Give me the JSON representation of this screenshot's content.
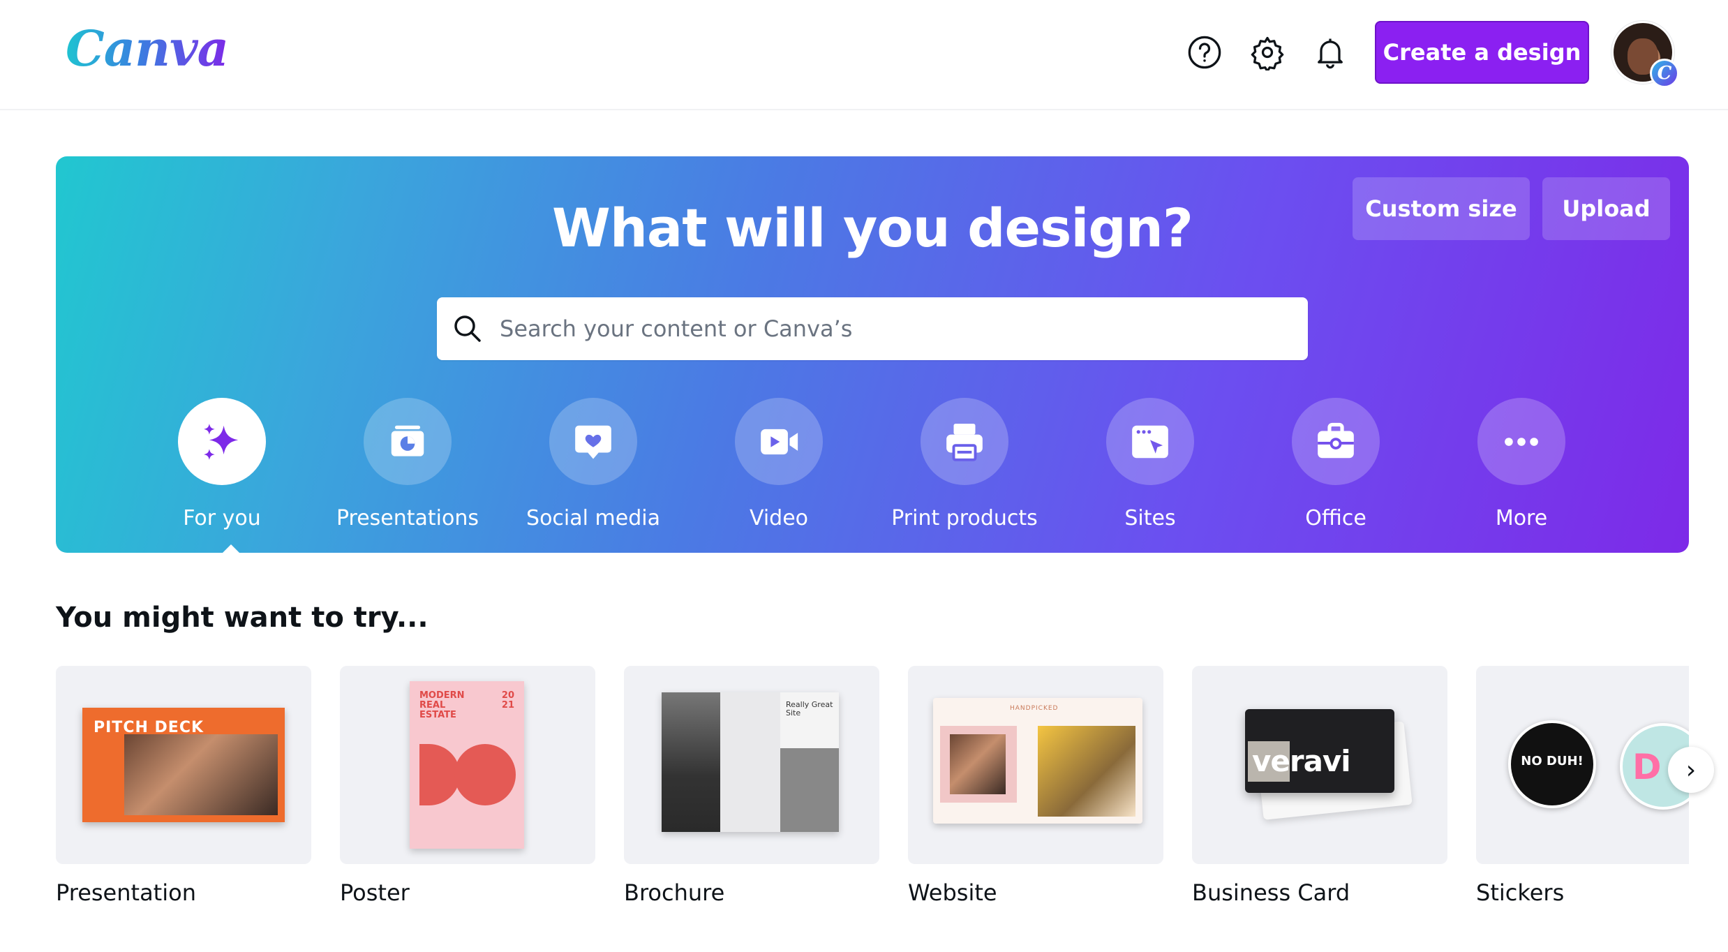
{
  "header": {
    "logo": "Canva",
    "icons": [
      "help-icon",
      "settings-icon",
      "bell-icon"
    ],
    "create_button": "Create a design",
    "avatar_badge": "C"
  },
  "hero": {
    "title": "What will you design?",
    "custom_size": "Custom size",
    "upload": "Upload",
    "search_placeholder": "Search your content or Canva’s",
    "categories": [
      {
        "label": "For you",
        "icon": "sparkle-icon",
        "active": true
      },
      {
        "label": "Presentations",
        "icon": "presentation-icon"
      },
      {
        "label": "Social media",
        "icon": "heart-chat-icon"
      },
      {
        "label": "Video",
        "icon": "video-camera-icon"
      },
      {
        "label": "Print products",
        "icon": "printer-icon"
      },
      {
        "label": "Sites",
        "icon": "cursor-window-icon"
      },
      {
        "label": "Office",
        "icon": "briefcase-icon"
      },
      {
        "label": "More",
        "icon": "more-dots-icon"
      }
    ],
    "gradient": [
      "#21c7d0",
      "#4b7ae4",
      "#7d2ae8"
    ]
  },
  "suggestions": {
    "title": "You might want to try...",
    "items": [
      {
        "label": "Presentation",
        "thumb_text": "PITCH DECK"
      },
      {
        "label": "Poster",
        "thumb_text": "MODERN REAL ESTATE",
        "thumb_year": "20 21"
      },
      {
        "label": "Brochure",
        "thumb_text": "Really Great Site"
      },
      {
        "label": "Website",
        "thumb_text": "HANDPICKED"
      },
      {
        "label": "Business Card",
        "thumb_text": "veravi"
      },
      {
        "label": "Stickers",
        "thumb_text": "NO DUH!"
      }
    ],
    "next_icon": "chevron-right-icon"
  },
  "colors": {
    "accent": "#8b20f1",
    "text": "#0e1318",
    "card_bg": "#f0f1f5"
  }
}
